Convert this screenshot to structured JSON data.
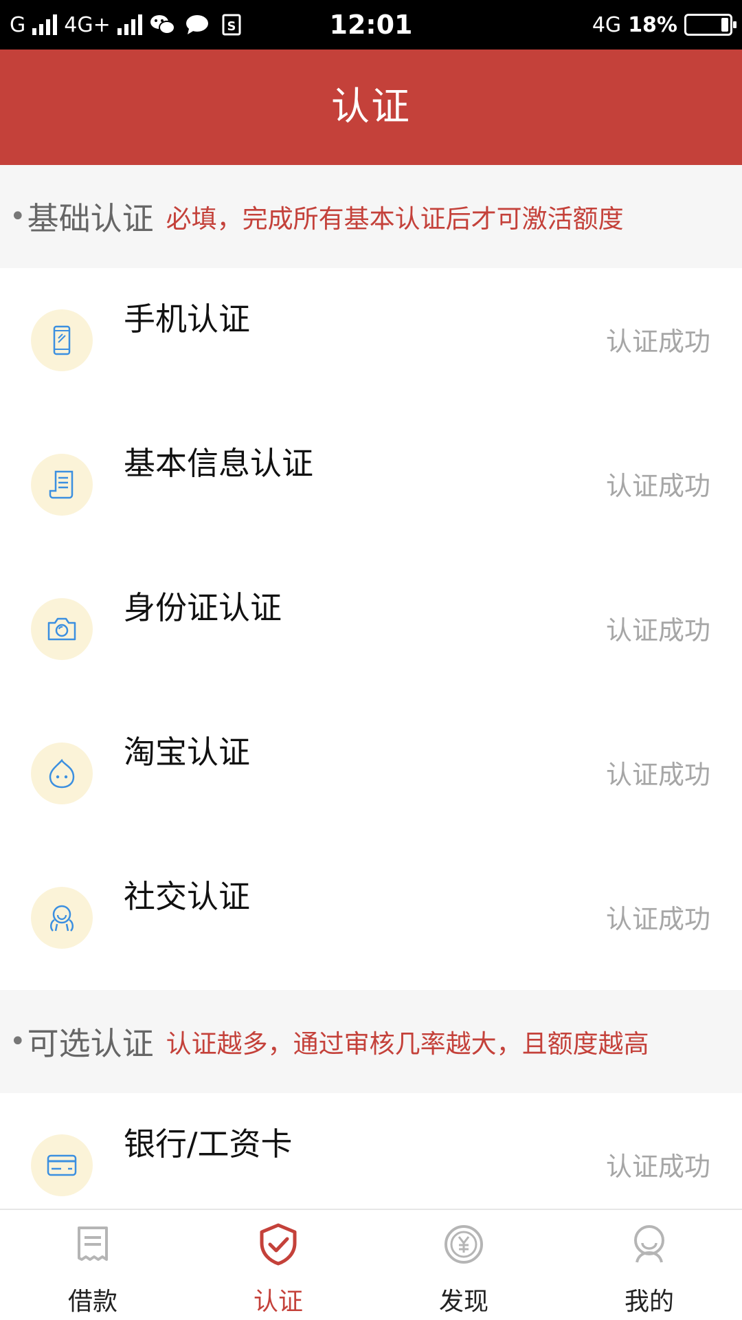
{
  "status_bar": {
    "carrier1": "G",
    "carrier2": "4G+",
    "time": "12:01",
    "network_right": "4G",
    "battery": "18%"
  },
  "header": {
    "title": "认证"
  },
  "sections": [
    {
      "dot": "•",
      "name": "基础认证",
      "note": "必填，完成所有基本认证后才可激活额度"
    },
    {
      "dot": "•",
      "name": "可选认证",
      "note": "认证越多，通过审核几率越大，且额度越高"
    }
  ],
  "basic_items": [
    {
      "label": "手机认证",
      "status": "认证成功",
      "icon": "phone-icon"
    },
    {
      "label": "基本信息认证",
      "status": "认证成功",
      "icon": "document-icon"
    },
    {
      "label": "身份证认证",
      "status": "认证成功",
      "icon": "camera-icon"
    },
    {
      "label": "淘宝认证",
      "status": "认证成功",
      "icon": "taobao-icon"
    },
    {
      "label": "社交认证",
      "status": "认证成功",
      "icon": "social-icon"
    }
  ],
  "optional_items": [
    {
      "label": "银行/工资卡",
      "status": "认证成功",
      "icon": "bank-card-icon"
    }
  ],
  "nav": [
    {
      "label": "借款",
      "icon": "loan-icon",
      "active": false
    },
    {
      "label": "认证",
      "icon": "shield-check-icon",
      "active": true
    },
    {
      "label": "发现",
      "icon": "yuan-coin-icon",
      "active": false
    },
    {
      "label": "我的",
      "icon": "user-icon",
      "active": false
    }
  ],
  "colors": {
    "brand": "#c4413a",
    "icon_blue": "#3b8fe0",
    "icon_bg": "#fbf3d8",
    "status_gray": "#a6a6a6"
  }
}
